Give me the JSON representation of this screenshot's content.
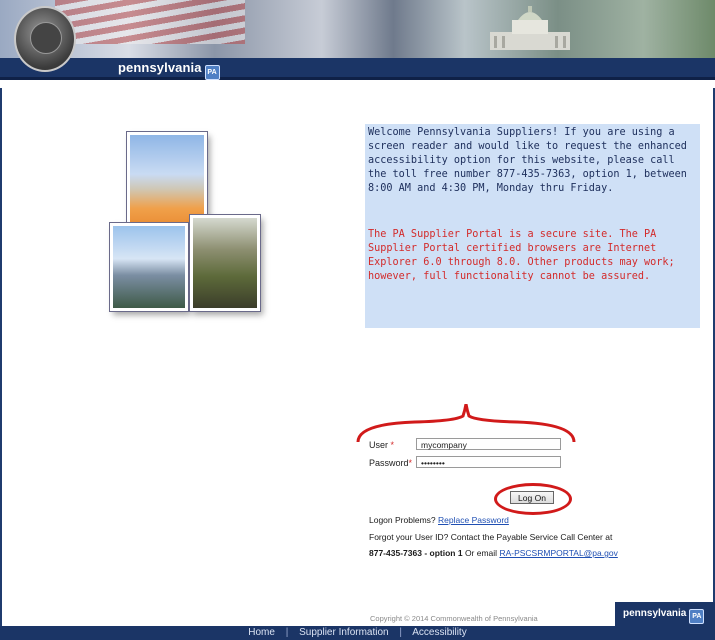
{
  "header": {
    "brand_text": "pennsylvania",
    "brand_badge": "PA"
  },
  "welcome": {
    "message": "Welcome Pennsylvania Suppliers! If you are using a screen reader and would like to request the enhanced accessibility option for this website, please call the toll free number 877-435-7363, option 1, between 8:00 AM and 4:30 PM, Monday thru Friday.",
    "notice": "The PA Supplier Portal is a secure site. The PA Supplier Portal certified browsers are Internet Explorer 6.0 through 8.0. Other products may work; however, full functionality cannot be assured."
  },
  "login": {
    "user_label": "User",
    "password_label": "Password",
    "required_mark": "*",
    "user_value": "mycompany",
    "password_value": "••••••••",
    "logon_button": "Log On"
  },
  "help": {
    "problems_text": "Logon Problems?",
    "replace_password_link": "Replace Password",
    "forgot_text": "Forgot your User ID? Contact the Payable Service Call Center at",
    "phone": "877-435-7363",
    "option_text": "- option 1",
    "or_email": "Or email",
    "email_link": "RA-PSCSRMPORTAL@pa.gov"
  },
  "footer": {
    "copyright": "Copyright © 2014 Commonwealth of Pennsylvania",
    "logo_text": "pennsylvania",
    "links": [
      "Home",
      "Supplier Information",
      "Accessibility"
    ],
    "separator": "|"
  },
  "colors": {
    "navy": "#1b3566",
    "welcome_bg": "#cfe0f6",
    "alert_red": "#d32b2b",
    "annotation_red": "#d11a1a",
    "link_blue": "#1f4fb3"
  }
}
